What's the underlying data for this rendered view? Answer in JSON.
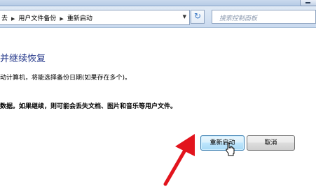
{
  "address_bar": {
    "breadcrumbs": [
      "去",
      "用户文件备份",
      "重新启动"
    ],
    "search_placeholder": "搜索控制面板"
  },
  "dialog": {
    "heading": "并继续恢复",
    "instruction": "动计算机，将能选择备份日期(如果存在多个)。",
    "warning": "数据。如果继续，则可能会丢失文档、图片和音乐等用户文件。"
  },
  "buttons": {
    "restart_label": "重新启动",
    "cancel_label": "取消"
  },
  "colors": {
    "heading": "#1e3287",
    "annotation_arrow": "#e2141d"
  },
  "icons": [
    "minimize-icon",
    "breadcrumb-separator-icon",
    "dropdown-icon",
    "refresh-icon",
    "mouse-cursor-icon",
    "red-arrow-annotation"
  ]
}
